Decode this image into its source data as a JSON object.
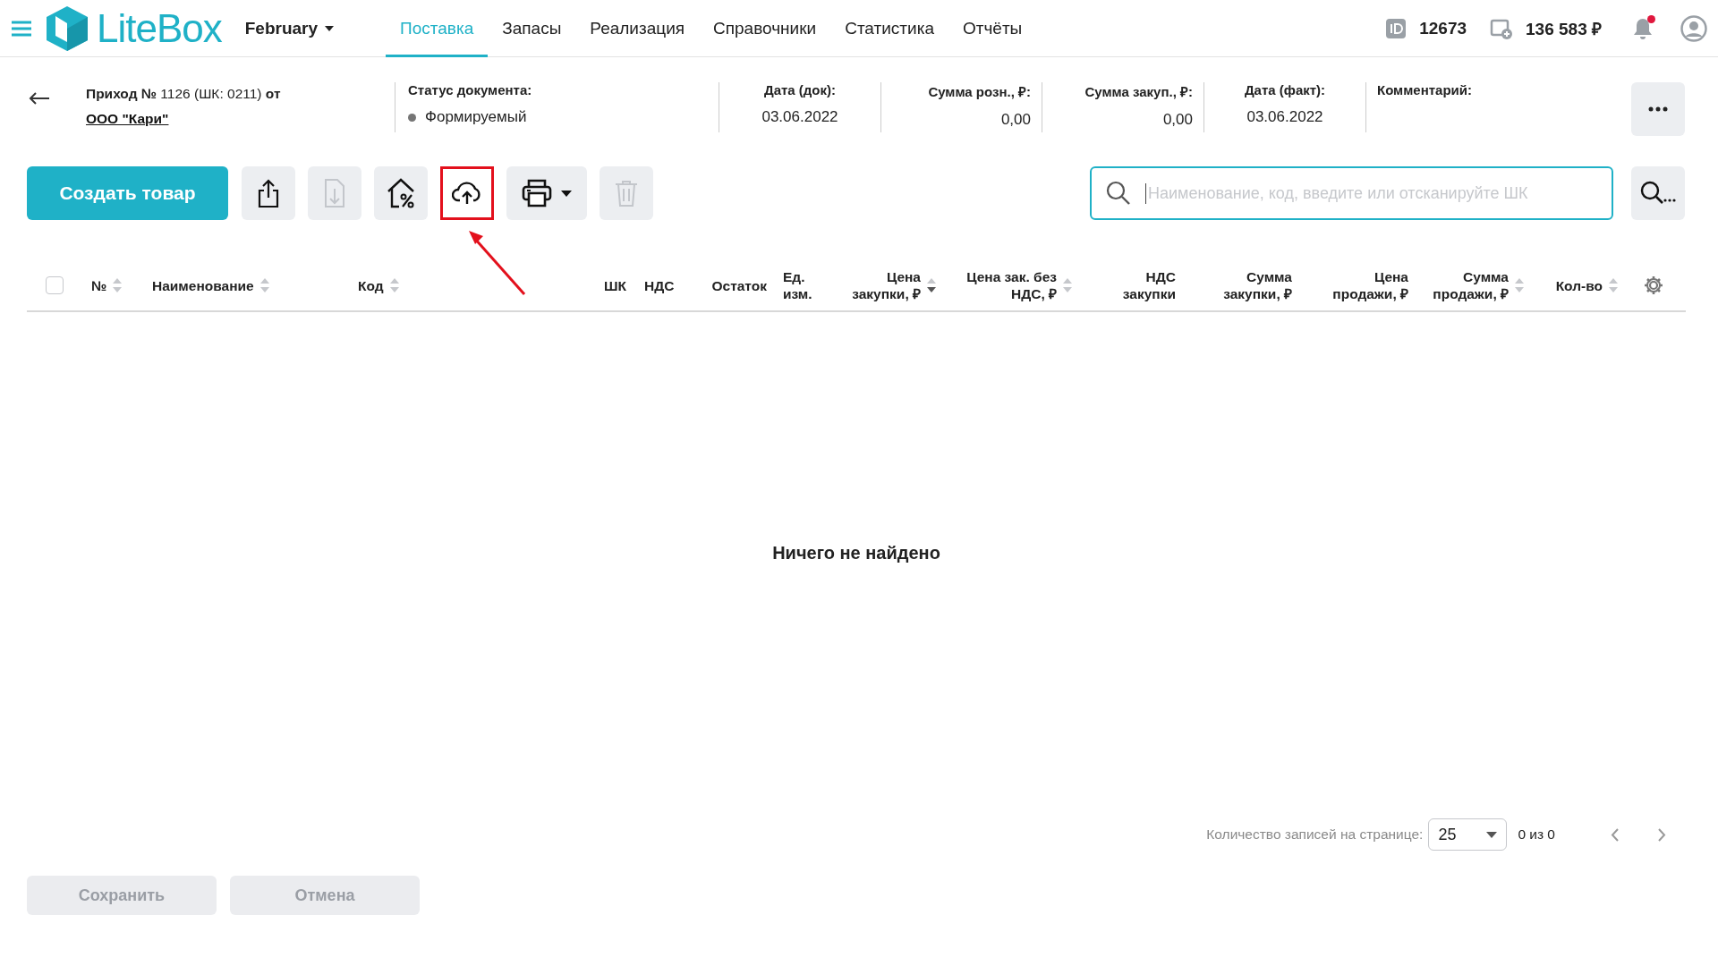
{
  "header": {
    "app_name": "LiteBox",
    "store": "February",
    "nav": [
      {
        "label": "Поставка",
        "selected": true
      },
      {
        "label": "Запасы",
        "selected": false
      },
      {
        "label": "Реализация",
        "selected": false
      },
      {
        "label": "Справочники",
        "selected": false
      },
      {
        "label": "Статистика",
        "selected": false
      },
      {
        "label": "Отчёты",
        "selected": false
      }
    ],
    "user_id": "12673",
    "balance": "136 583 ₽",
    "unread_notifications": true
  },
  "document": {
    "title": "**Приход №** 1126 (ШК: 0211) **от**",
    "supplier": "ООО \"Кари\"",
    "fields": [
      {
        "kind": "status",
        "label": "Статус документа:",
        "value": "Формируемый"
      },
      {
        "kind": "date",
        "label": "Дата (док):",
        "value": "03.06.2022"
      },
      {
        "kind": "money",
        "label": "Сумма розн., ₽:",
        "value": "0,00"
      },
      {
        "kind": "money",
        "label": "Сумма закуп., ₽:",
        "value": "0,00"
      },
      {
        "kind": "date",
        "label": "Дата (факт):",
        "value": "03.06.2022"
      },
      {
        "kind": "text",
        "label": "Комментарий:"
      }
    ]
  },
  "toolbar": {
    "create_button": "Создать товар",
    "tools": [
      {
        "kind": "export",
        "disabled": false,
        "highlighted": false
      },
      {
        "kind": "import",
        "disabled": true,
        "highlighted": false
      },
      {
        "kind": "discount",
        "disabled": false,
        "highlighted": false
      },
      {
        "kind": "upload",
        "disabled": false,
        "highlighted": true
      },
      {
        "kind": "print",
        "disabled": false,
        "highlighted": false
      },
      {
        "kind": "delete",
        "disabled": true,
        "highlighted": false
      }
    ],
    "search": {
      "placeholder": "Наименование, код, введите или отсканируйте ШК"
    }
  },
  "table": {
    "select_all": {
      "checked": false
    },
    "columns": [
      {
        "label": "№",
        "kind": "text",
        "sortable": true,
        "sorted": false
      },
      {
        "label": "Наименование",
        "kind": "text",
        "sortable": true,
        "sorted": false
      },
      {
        "label": "Код",
        "kind": "text",
        "sortable": true,
        "sorted": false
      },
      {
        "label": "ШК",
        "kind": "text"
      },
      {
        "label": "НДС",
        "kind": "text"
      },
      {
        "label": "Остаток",
        "kind": "number"
      },
      {
        "label": "Ед.\nизм.",
        "kind": "text"
      },
      {
        "label": "Цена\nзакупки, ₽",
        "kind": "number",
        "sortable": true,
        "sorted": true
      },
      {
        "label": "Цена зак. без\nНДС, ₽",
        "kind": "number",
        "sortable": true,
        "sorted": false
      },
      {
        "label": "НДС\nзакупки",
        "kind": "number"
      },
      {
        "label": "Сумма\nзакупки, ₽",
        "kind": "number"
      },
      {
        "label": "Цена\nпродажи, ₽",
        "kind": "number"
      },
      {
        "label": "Сумма\nпродажи, ₽",
        "kind": "number",
        "sortable": true,
        "sorted": false
      },
      {
        "label": "Кол-во",
        "kind": "number",
        "sortable": true,
        "sorted": false
      }
    ],
    "empty_message": "Ничего не найдено"
  },
  "pagination": {
    "label": "Количество записей на странице:",
    "page_size": "25",
    "range": "0 из 0"
  },
  "actions": [
    {
      "label": "Сохранить",
      "disabled": true
    },
    {
      "label": "Отмена",
      "disabled": true
    }
  ]
}
